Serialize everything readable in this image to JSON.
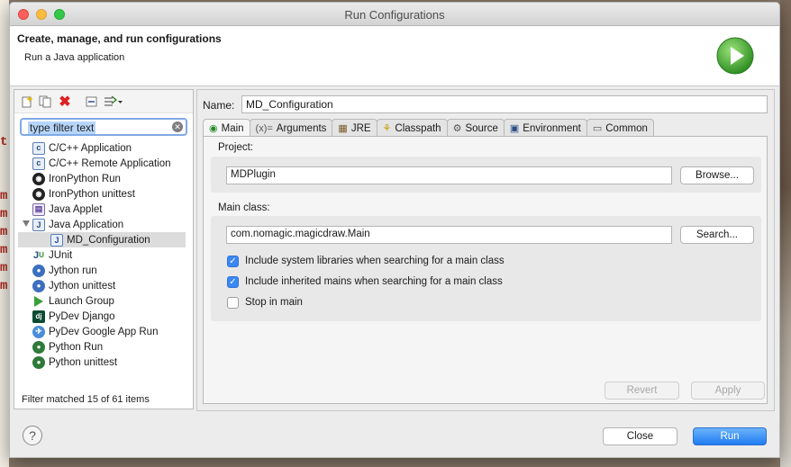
{
  "window": {
    "title": "Run Configurations"
  },
  "header": {
    "title": "Create, manage, and run configurations",
    "subtitle": "Run a Java application",
    "icon": "run-play-icon"
  },
  "left": {
    "toolbar": [
      "new-config-icon",
      "duplicate-icon",
      "delete-icon",
      "collapse-all-icon",
      "filter-menu-icon"
    ],
    "filter": {
      "value": "type filter text"
    },
    "tree": [
      {
        "label": "C/C++ Application",
        "icon": "c-icon",
        "level": 1
      },
      {
        "label": "C/C++ Remote Application",
        "icon": "c-icon",
        "level": 1
      },
      {
        "label": "IronPython Run",
        "icon": "ironpython-icon",
        "level": 0
      },
      {
        "label": "IronPython unittest",
        "icon": "ironpython-unittest-icon",
        "level": 0
      },
      {
        "label": "Java Applet",
        "icon": "java-applet-icon",
        "level": 0
      },
      {
        "label": "Java Application",
        "icon": "java-icon",
        "level": 0,
        "expanded": true
      },
      {
        "label": "MD_Configuration",
        "icon": "java-icon",
        "level": 1,
        "selected": true
      },
      {
        "label": "JUnit",
        "icon": "junit-icon",
        "level": 0
      },
      {
        "label": "Jython run",
        "icon": "jython-icon",
        "level": 0
      },
      {
        "label": "Jython unittest",
        "icon": "jython-unittest-icon",
        "level": 0
      },
      {
        "label": "Launch Group",
        "icon": "launch-group-icon",
        "level": 0
      },
      {
        "label": "PyDev Django",
        "icon": "django-icon",
        "level": 0
      },
      {
        "label": "PyDev Google App Run",
        "icon": "google-app-icon",
        "level": 0
      },
      {
        "label": "Python Run",
        "icon": "python-icon",
        "level": 0
      },
      {
        "label": "Python unittest",
        "icon": "python-unittest-icon",
        "level": 0
      }
    ],
    "status": "Filter matched 15 of 61 items"
  },
  "config": {
    "name_label": "Name:",
    "name_value": "MD_Configuration",
    "tabs": [
      {
        "label": "Main",
        "icon": "main-class-icon",
        "active": true
      },
      {
        "label": "Arguments",
        "icon": "arguments-icon"
      },
      {
        "label": "JRE",
        "icon": "jre-icon"
      },
      {
        "label": "Classpath",
        "icon": "classpath-icon"
      },
      {
        "label": "Source",
        "icon": "source-icon"
      },
      {
        "label": "Environment",
        "icon": "environment-icon"
      },
      {
        "label": "Common",
        "icon": "common-icon"
      }
    ],
    "project": {
      "label": "Project:",
      "value": "MDPlugin",
      "button": "Browse..."
    },
    "main_class": {
      "label": "Main class:",
      "value": "com.nomagic.magicdraw.Main",
      "button": "Search..."
    },
    "options": [
      {
        "label": "Include system libraries when searching for a main class",
        "checked": true
      },
      {
        "label": "Include inherited mains when searching for a main class",
        "checked": true
      },
      {
        "label": "Stop in main",
        "checked": false
      }
    ],
    "revert": "Revert",
    "apply": "Apply"
  },
  "footer": {
    "close": "Close",
    "run": "Run",
    "help": "?"
  }
}
